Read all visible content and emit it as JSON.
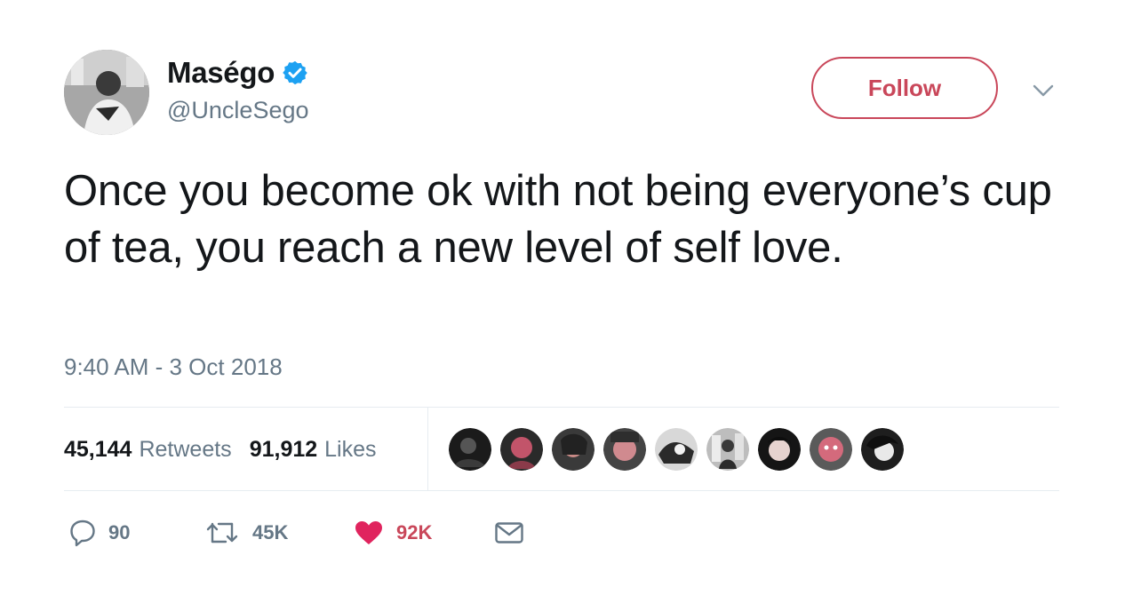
{
  "user": {
    "display_name": "Maségo",
    "handle": "@UncleSego",
    "verified_icon": "verified-badge-icon"
  },
  "follow_label": "Follow",
  "tweet": {
    "text": "Once you become ok with not being everyone’s cup of tea, you reach a new level of self love.",
    "timestamp": "9:40 AM - 3 Oct 2018"
  },
  "stats": {
    "retweets_count": "45,144",
    "retweets_label": "Retweets",
    "likes_count": "91,912",
    "likes_label": "Likes"
  },
  "actions": {
    "reply_count": "90",
    "retweet_count": "45K",
    "like_count": "92K"
  },
  "colors": {
    "accent": "#c9475a",
    "verified": "#1da1f2",
    "secondary_text": "#657786"
  }
}
